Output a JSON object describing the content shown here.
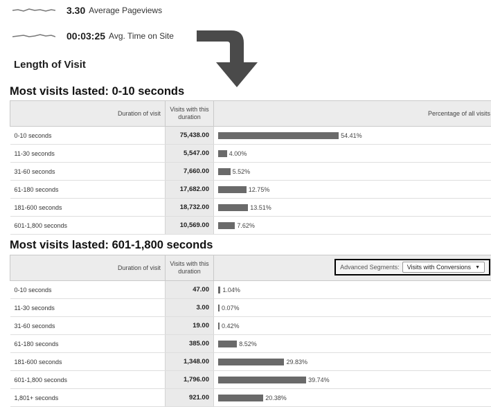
{
  "metrics": [
    {
      "value": "3.30",
      "label": "Average Pageviews"
    },
    {
      "value": "00:03:25",
      "label": "Avg. Time on Site"
    }
  ],
  "section_heading": "Length of Visit",
  "tables": [
    {
      "title": "Most visits lasted: 0-10 seconds",
      "headers": {
        "duration": "Duration of visit",
        "visits": "Visits with this duration",
        "percentage": "Percentage of all visits"
      },
      "rows": [
        {
          "duration": "0-10 seconds",
          "visits": "75,438.00",
          "pct": "54.41%",
          "pct_value": 54.41
        },
        {
          "duration": "11-30 seconds",
          "visits": "5,547.00",
          "pct": "4.00%",
          "pct_value": 4.0
        },
        {
          "duration": "31-60 seconds",
          "visits": "7,660.00",
          "pct": "5.52%",
          "pct_value": 5.52
        },
        {
          "duration": "61-180 seconds",
          "visits": "17,682.00",
          "pct": "12.75%",
          "pct_value": 12.75
        },
        {
          "duration": "181-600 seconds",
          "visits": "18,732.00",
          "pct": "13.51%",
          "pct_value": 13.51
        },
        {
          "duration": "601-1,800 seconds",
          "visits": "10,569.00",
          "pct": "7.62%",
          "pct_value": 7.62
        }
      ]
    },
    {
      "title": "Most visits lasted: 601-1,800 seconds",
      "headers": {
        "duration": "Duration of visit",
        "visits": "Visits with this duration"
      },
      "segment": {
        "label": "Advanced Segments:",
        "value": "Visits with Conversions"
      },
      "rows": [
        {
          "duration": "0-10 seconds",
          "visits": "47.00",
          "pct": "1.04%",
          "pct_value": 1.04
        },
        {
          "duration": "11-30 seconds",
          "visits": "3.00",
          "pct": "0.07%",
          "pct_value": 0.07
        },
        {
          "duration": "31-60 seconds",
          "visits": "19.00",
          "pct": "0.42%",
          "pct_value": 0.42
        },
        {
          "duration": "61-180 seconds",
          "visits": "385.00",
          "pct": "8.52%",
          "pct_value": 8.52
        },
        {
          "duration": "181-600 seconds",
          "visits": "1,348.00",
          "pct": "29.83%",
          "pct_value": 29.83
        },
        {
          "duration": "601-1,800 seconds",
          "visits": "1,796.00",
          "pct": "39.74%",
          "pct_value": 39.74
        },
        {
          "duration": "1,801+ seconds",
          "visits": "921.00",
          "pct": "20.38%",
          "pct_value": 20.38
        }
      ]
    }
  ],
  "colors": {
    "bar": "#6a6a6a",
    "header_bg": "#ececec"
  }
}
